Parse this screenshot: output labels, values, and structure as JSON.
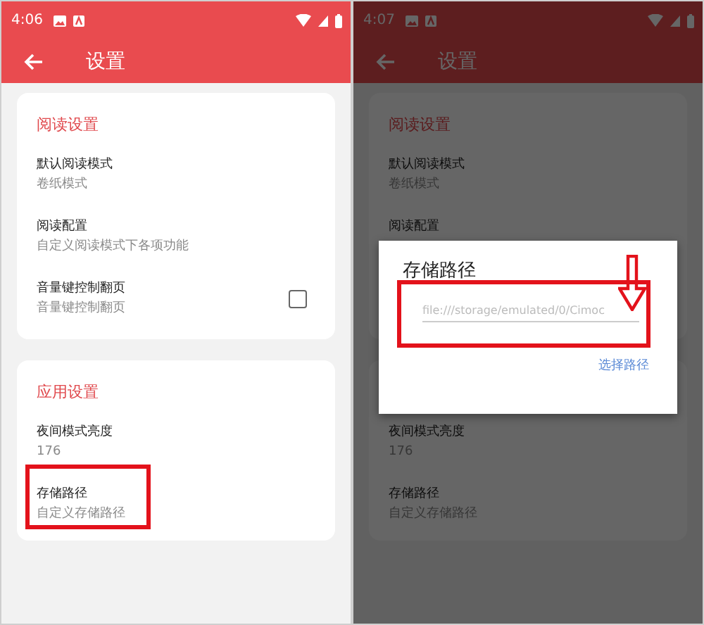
{
  "screens": [
    {
      "status_bar": {
        "time": "4:06"
      },
      "app_bar": {
        "title": "设置"
      },
      "sections": [
        {
          "title": "阅读设置",
          "items": [
            {
              "kind": "text",
              "title": "默认阅读模式",
              "subtitle": "卷纸模式"
            },
            {
              "kind": "text",
              "title": "阅读配置",
              "subtitle": "自定义阅读模式下各项功能"
            },
            {
              "kind": "checkbox",
              "title": "音量键控制翻页",
              "subtitle": "音量键控制翻页",
              "checked": false
            }
          ]
        },
        {
          "title": "应用设置",
          "items": [
            {
              "kind": "text",
              "title": "夜间模式亮度",
              "subtitle": "176"
            },
            {
              "kind": "text",
              "title": "存储路径",
              "subtitle": "自定义存储路径",
              "highlighted": true
            }
          ]
        }
      ]
    },
    {
      "status_bar": {
        "time": "4:07"
      },
      "app_bar": {
        "title": "设置"
      },
      "dimmed": true,
      "sections": [
        {
          "title": "阅读设置",
          "items": [
            {
              "kind": "text",
              "title": "默认阅读模式",
              "subtitle": "卷纸模式"
            },
            {
              "kind": "text",
              "title": "阅读配置"
            }
          ]
        },
        {
          "items": [
            {
              "kind": "text",
              "title": "夜间模式亮度",
              "subtitle": "176"
            },
            {
              "kind": "text",
              "title": "存储路径",
              "subtitle": "自定义存储路径"
            }
          ]
        }
      ],
      "dialog": {
        "title": "存储路径",
        "field": {
          "placeholder": "file:///storage/emulated/0/Cimoc",
          "highlighted": true,
          "pointer_arrow": true
        },
        "button": "选择路径"
      }
    }
  ]
}
